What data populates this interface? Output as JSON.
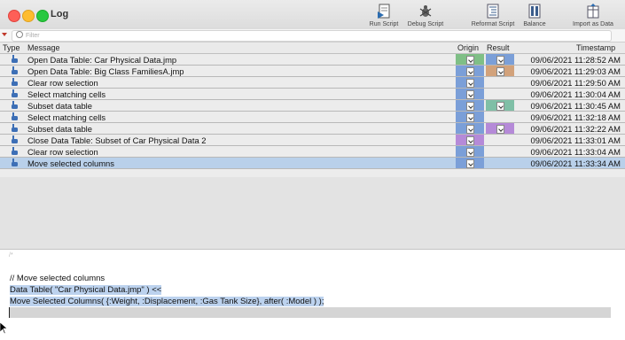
{
  "window": {
    "title": "Log"
  },
  "toolbar": [
    {
      "label": "Run Script",
      "icon": "run-script-icon"
    },
    {
      "label": "Debug Script",
      "icon": "debug-script-icon"
    },
    {
      "label": "Reformat Script",
      "icon": "reformat-script-icon"
    },
    {
      "label": "Balance",
      "icon": "balance-icon"
    },
    {
      "label": "Import as Data",
      "icon": "import-as-data-icon"
    }
  ],
  "filter": {
    "placeholder": "Filter"
  },
  "columns": {
    "type": "Type",
    "message": "Message",
    "origin": "Origin",
    "result": "Result",
    "timestamp": "Timestamp"
  },
  "rows": [
    {
      "message": "Open Data Table: Car Physical Data.jmp",
      "origin_color": "#7fbf86",
      "result_color": "#7b9fd8",
      "timestamp": "09/06/2021 11:28:52 AM"
    },
    {
      "message": "Open Data Table: Big Class FamiliesA.jmp",
      "origin_color": "#7b9fd8",
      "result_color": "#d2a27b",
      "timestamp": "09/06/2021 11:29:03 AM"
    },
    {
      "message": "Clear row selection",
      "origin_color": "#7b9fd8",
      "result_color": "",
      "timestamp": "09/06/2021 11:29:50 AM"
    },
    {
      "message": "Select matching cells",
      "origin_color": "#7b9fd8",
      "result_color": "",
      "timestamp": "09/06/2021 11:30:04 AM"
    },
    {
      "message": "Subset data table",
      "origin_color": "#7b9fd8",
      "result_color": "#7fbfa6",
      "timestamp": "09/06/2021 11:30:45 AM"
    },
    {
      "message": "Select matching cells",
      "origin_color": "#7b9fd8",
      "result_color": "",
      "timestamp": "09/06/2021 11:32:18 AM"
    },
    {
      "message": "Subset data table",
      "origin_color": "#7b9fd8",
      "result_color": "#b58ad8",
      "timestamp": "09/06/2021 11:32:22 AM"
    },
    {
      "message": "Close Data Table: Subset of Car Physical Data 2",
      "origin_color": "#b58ad8",
      "result_color": "",
      "timestamp": "09/06/2021 11:33:01 AM"
    },
    {
      "message": "Clear row selection",
      "origin_color": "#7b9fd8",
      "result_color": "",
      "timestamp": "09/06/2021 11:33:04 AM"
    },
    {
      "message": "Move selected columns",
      "origin_color": "#7b9fd8",
      "result_color": "",
      "timestamp": "09/06/2021 11:33:34 AM",
      "selected": true
    }
  ],
  "editor": {
    "comment": "// Move selected columns",
    "line1": "Data Table( \"Car Physical Data.jmp\" ) <<",
    "line2": "Move Selected Columns( {:Weight, :Displacement, :Gas Tank Size}, after( :Model ) );"
  }
}
